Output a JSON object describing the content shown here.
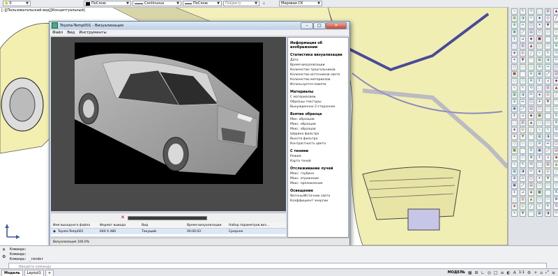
{
  "topbar": {
    "layer_value": "0",
    "color_value": "ПоСлою",
    "linetype_value": "Continuous",
    "lineweight_value": "ПоСлою",
    "plotstyle_value": "ПоЦвету",
    "ucs_value": "Мировая СК"
  },
  "viewport": {
    "label": "[–][Пользовательский вид][Концептуальный]"
  },
  "render_window": {
    "title": "Toyota-Temp001 - Визуализация",
    "menu": [
      "Файл",
      "Вид",
      "Инструменты"
    ],
    "info": {
      "header": "Информация об изображении",
      "sections": [
        {
          "title": "Статистика визуализации",
          "items": [
            "Дата",
            "Время визуализации",
            "Количество треугольников",
            "Количество источников света",
            "Количество материалов",
            "Используется памяти"
          ]
        },
        {
          "title": "Материалы",
          "items": [
            "С материалами",
            "Образцы текстуры",
            "Вынужденное 2-стороннее"
          ]
        },
        {
          "title": "Взятие образца",
          "items": [
            "Мин. образцов",
            "Макс. образцов",
            "Макс. образцов",
            "Ширина фильтра",
            "Высота фильтра",
            "Контрастность цвета"
          ]
        },
        {
          "title": "С тенями",
          "items": [
            "Режим",
            "Карта теней"
          ]
        },
        {
          "title": "Отслеживание лучей",
          "items": [
            "Макс. глубина",
            "Макс. отражение",
            "Макс. преломление"
          ]
        },
        {
          "title": "Освещение",
          "items": [
            "Фотоны/Источник света",
            "Коэффициент энергии"
          ]
        }
      ]
    },
    "list": {
      "headers": [
        "Имя выходного файла",
        "Формат вывода",
        "Вид",
        "Время визуализации",
        "Набор параметров виз..."
      ],
      "row": [
        "Toyota-Temp001",
        "640 X 480",
        "Текущий",
        "00:00:02",
        "Среднее"
      ]
    },
    "status": "Визуализация 100.0%",
    "progress": 1.0
  },
  "command": {
    "lines": [
      "Команда:",
      "Команда:",
      "Команда:  _render"
    ],
    "placeholder": "Введите команду"
  },
  "status_bar": {
    "tabs": [
      "Модель",
      "Layout1"
    ],
    "model_label": "МОДЕЛЬ",
    "scale": "1:1"
  }
}
